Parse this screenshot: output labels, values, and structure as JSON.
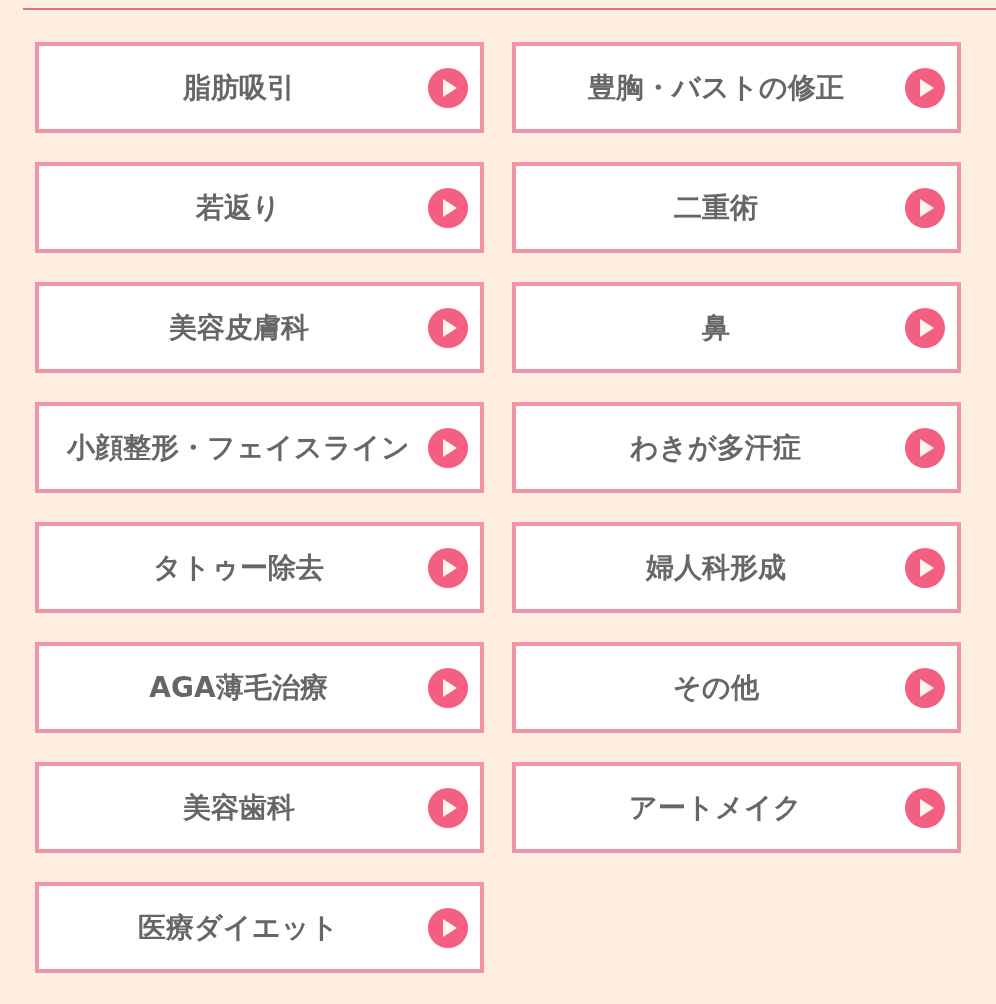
{
  "menu": {
    "items": [
      {
        "label": "脂肪吸引"
      },
      {
        "label": "豊胸・バストの修正"
      },
      {
        "label": "若返り"
      },
      {
        "label": "二重術"
      },
      {
        "label": "美容皮膚科"
      },
      {
        "label": "鼻"
      },
      {
        "label": "小顔整形・フェイスライン"
      },
      {
        "label": "わきが多汗症"
      },
      {
        "label": "タトゥー除去"
      },
      {
        "label": "婦人科形成"
      },
      {
        "label": "AGA薄毛治療"
      },
      {
        "label": "その他"
      },
      {
        "label": "美容歯科"
      },
      {
        "label": "アートメイク"
      },
      {
        "label": "医療ダイエット"
      }
    ]
  }
}
